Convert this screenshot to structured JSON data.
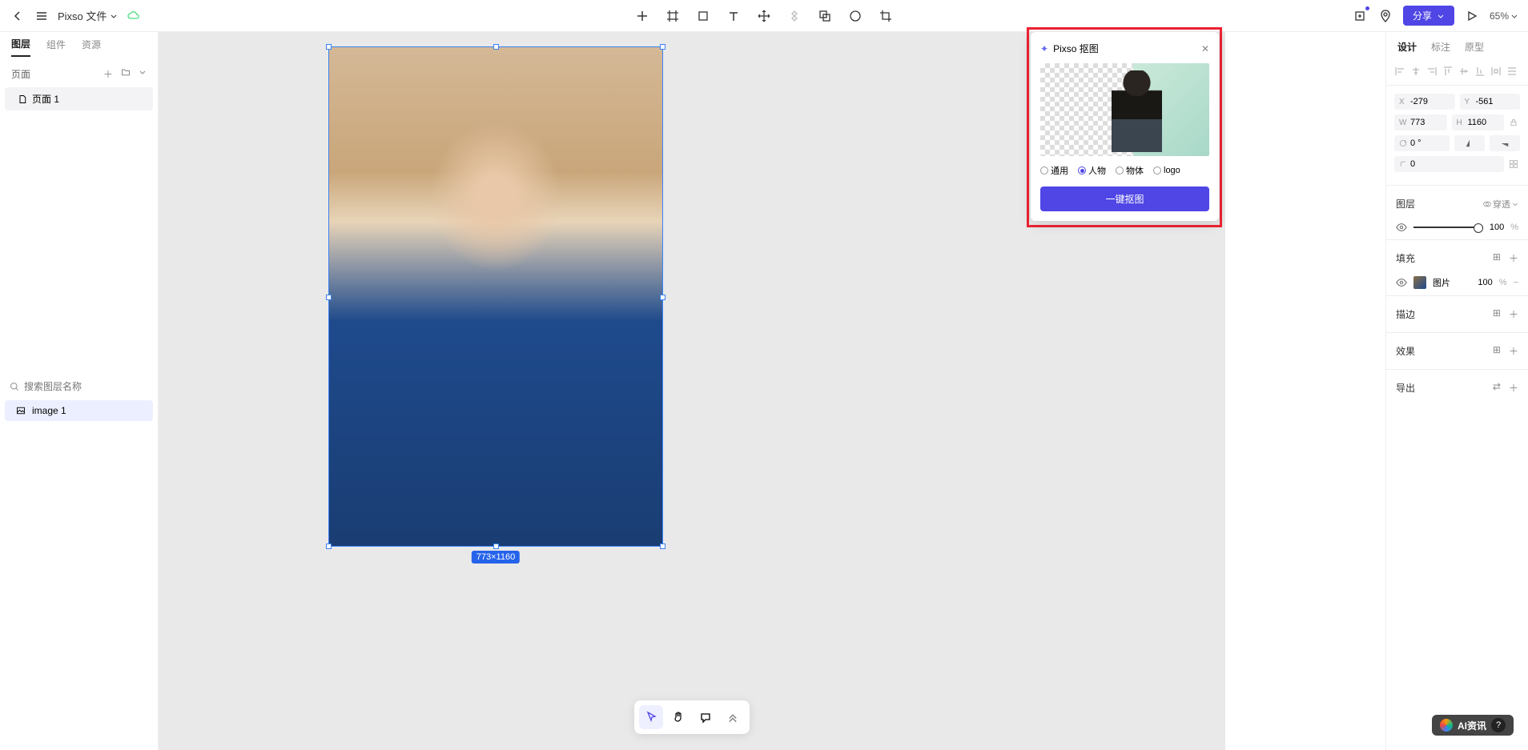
{
  "header": {
    "doc_title": "Pixso 文件",
    "share_label": "分享",
    "zoom": "65%"
  },
  "left": {
    "tabs": [
      "图层",
      "组件",
      "资源"
    ],
    "active_tab": 0,
    "pages_label": "页面",
    "page_items": [
      "页面 1"
    ],
    "search_placeholder": "搜索图层名称",
    "layers": [
      "image 1"
    ]
  },
  "canvas": {
    "dimension_badge": "773×1160"
  },
  "cutout": {
    "title": "Pixso 抠图",
    "options": [
      "通用",
      "人物",
      "物体",
      "logo"
    ],
    "selected_option": 1,
    "button": "一键抠图"
  },
  "right": {
    "tabs": [
      "设计",
      "标注",
      "原型"
    ],
    "active_tab": 0,
    "x_label": "X",
    "x_value": "-279",
    "y_label": "Y",
    "y_value": "-561",
    "w_label": "W",
    "w_value": "773",
    "h_label": "H",
    "h_value": "1160",
    "r_label": "",
    "r_value": "0 °",
    "c_value": "0",
    "section_layer": "图层",
    "passthrough": "穿透",
    "opacity": "100",
    "opacity_unit": "%",
    "section_fill": "填充",
    "fill_type": "图片",
    "fill_opacity": "100",
    "fill_unit": "%",
    "section_stroke": "描边",
    "section_effect": "效果",
    "section_export": "导出"
  },
  "watermark": {
    "text": "AI资讯",
    "badge": "?"
  }
}
